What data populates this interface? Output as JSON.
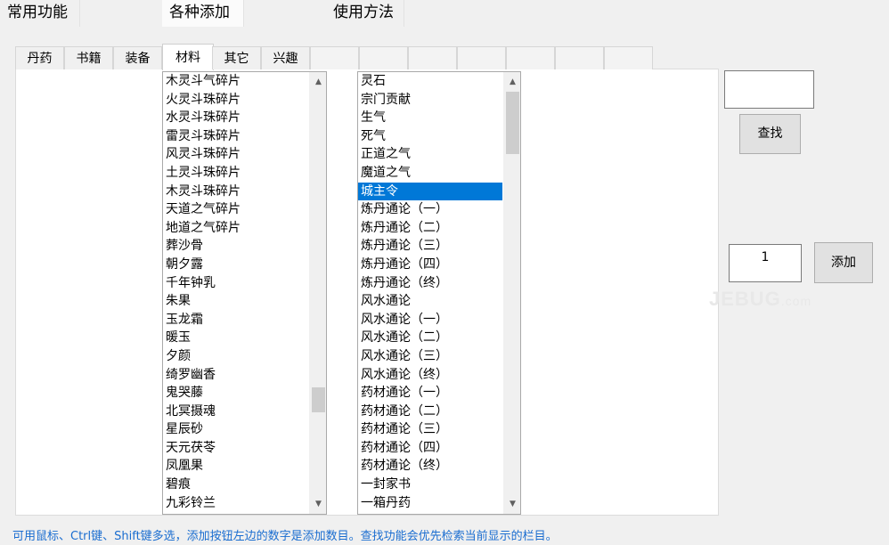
{
  "top_tabs": [
    {
      "label": "常用功能",
      "active": false
    },
    {
      "label": "各种添加",
      "active": true
    },
    {
      "label": "使用方法",
      "active": false
    }
  ],
  "sub_tabs": [
    "丹药",
    "书籍",
    "装备",
    "材料",
    "其它",
    "兴趣",
    "",
    "",
    "",
    "",
    "",
    "",
    ""
  ],
  "active_sub_tab": "材料",
  "left_list": {
    "items": [
      "木灵斗气碎片",
      "火灵斗珠碎片",
      "水灵斗珠碎片",
      "雷灵斗珠碎片",
      "风灵斗珠碎片",
      "土灵斗珠碎片",
      "木灵斗珠碎片",
      "天道之气碎片",
      "地道之气碎片",
      "葬沙骨",
      "朝夕露",
      "千年钟乳",
      "朱果",
      "玉龙霜",
      "暖玉",
      "夕颜",
      "绮罗幽香",
      "鬼哭藤",
      "北冥摄魂",
      "星辰砂",
      "天元茯苓",
      "凤凰果",
      "碧痕",
      "九彩铃兰"
    ]
  },
  "right_list": {
    "items": [
      "灵石",
      "宗门贡献",
      "生气",
      "死气",
      "正道之气",
      "魔道之气",
      "城主令",
      "炼丹通论（一）",
      "炼丹通论（二）",
      "炼丹通论（三）",
      "炼丹通论（四）",
      "炼丹通论（终）",
      "风水通论",
      "风水通论（一）",
      "风水通论（二）",
      "风水通论（三）",
      "风水通论（终）",
      "药材通论（一）",
      "药材通论（二）",
      "药材通论（三）",
      "药材通论（四）",
      "药材通论（终）",
      "一封家书",
      "一箱丹药"
    ],
    "selected": "城主令"
  },
  "search": {
    "value": "",
    "button_label": "查找"
  },
  "add": {
    "quantity": "1",
    "button_label": "添加"
  },
  "footer_text": "可用鼠标、Ctrl键、Shift键多选，添加按钮左边的数字是添加数目。查找功能会优先检索当前显示的栏目。",
  "watermark": {
    "main": "JEBUG",
    "sub": ".com"
  },
  "colors": {
    "selection": "#0078d7",
    "footer_text": "#1a6dd0",
    "window_bg": "#f0f0f0"
  }
}
